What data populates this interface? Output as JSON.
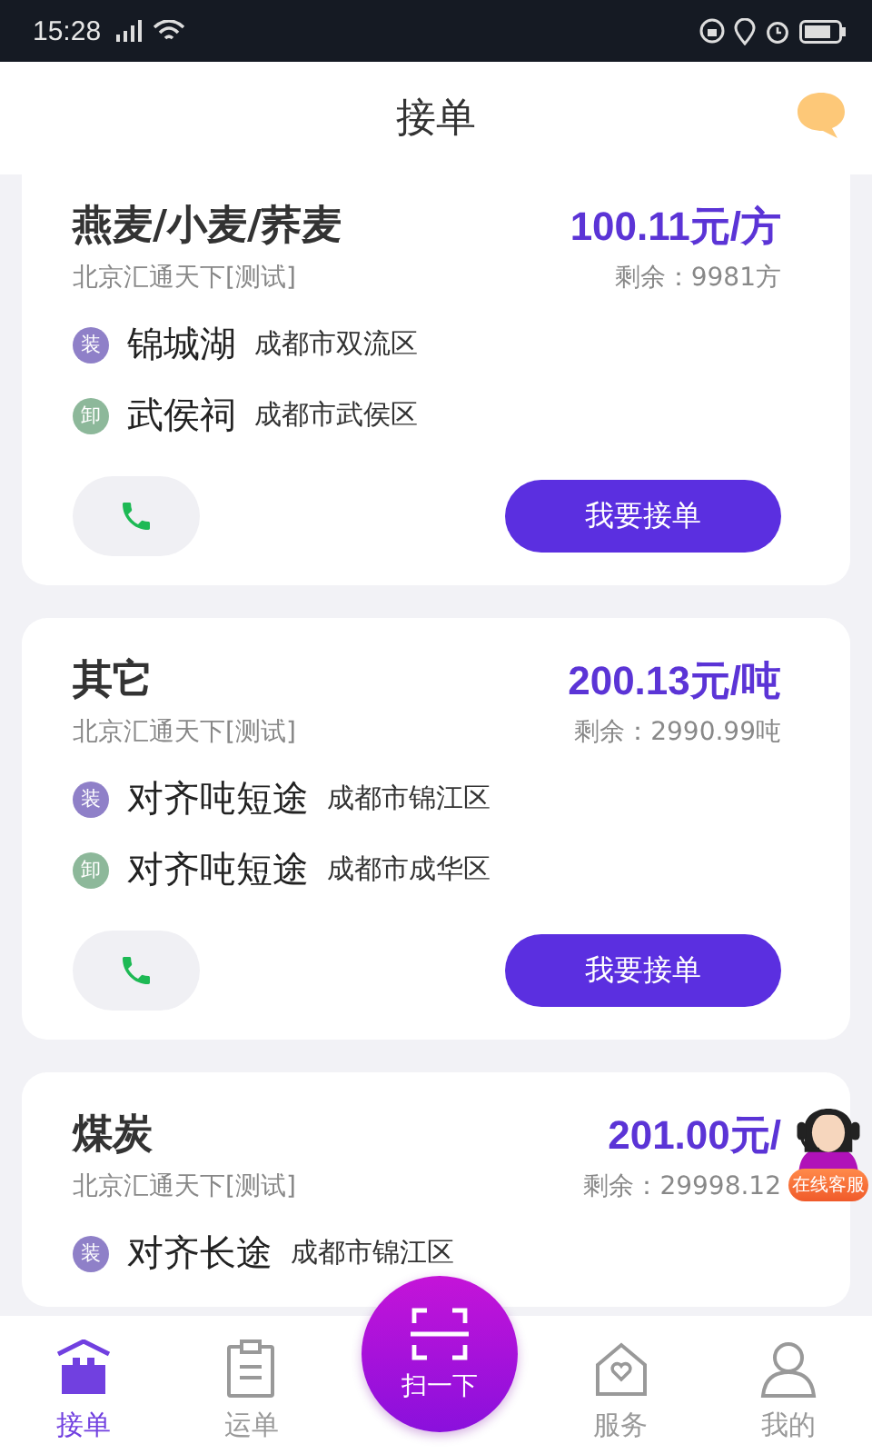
{
  "status_bar": {
    "time": "15:28"
  },
  "header": {
    "title": "接单"
  },
  "orders": [
    {
      "cargo": "燕麦/小麦/荞麦",
      "company": "北京汇通天下[测试]",
      "price": "100.11元/方",
      "remaining": "剩余：9981方",
      "stops": [
        {
          "kind": "load",
          "tag": "装",
          "place": "锦城湖",
          "address": "成都市双流区"
        },
        {
          "kind": "unload",
          "tag": "卸",
          "place": "武侯祠",
          "address": "成都市武侯区"
        }
      ],
      "accept_button": "我要接单"
    },
    {
      "cargo": "其它",
      "company": "北京汇通天下[测试]",
      "price": "200.13元/吨",
      "remaining": "剩余：2990.99吨",
      "stops": [
        {
          "kind": "load",
          "tag": "装",
          "place": "对齐吨短途",
          "address": "成都市锦江区"
        },
        {
          "kind": "unload",
          "tag": "卸",
          "place": "对齐吨短途",
          "address": "成都市成华区"
        }
      ],
      "accept_button": "我要接单"
    },
    {
      "cargo": "煤炭",
      "company": "北京汇通天下[测试]",
      "price": "201.00元/",
      "remaining": "剩余：29998.12",
      "stops": [
        {
          "kind": "load",
          "tag": "装",
          "place": "对齐长途",
          "address": "成都市锦江区"
        }
      ]
    }
  ],
  "support_badge": "在线客服",
  "scan_button": "扫一下",
  "nav": [
    {
      "kind": "orders",
      "label": "接单",
      "selected": true
    },
    {
      "kind": "waybill",
      "label": "运单",
      "selected": false
    },
    {
      "kind": "spacer"
    },
    {
      "kind": "service",
      "label": "服务",
      "selected": false
    },
    {
      "kind": "me",
      "label": "我的",
      "selected": false
    }
  ]
}
